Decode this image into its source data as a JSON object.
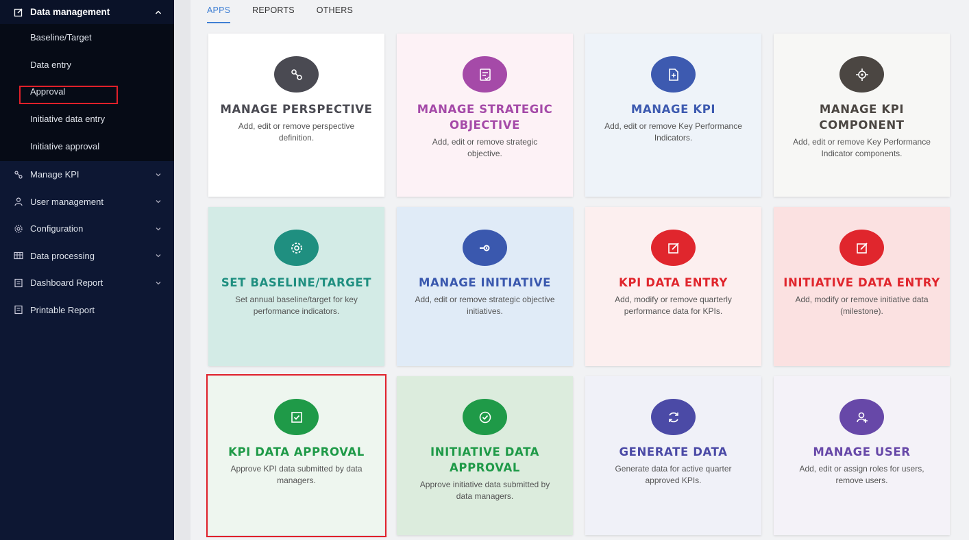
{
  "sidebar": {
    "group": {
      "label": "Data management"
    },
    "subitems": [
      {
        "label": "Baseline/Target"
      },
      {
        "label": "Data entry"
      },
      {
        "label": "Approval"
      },
      {
        "label": "Initiative data entry"
      },
      {
        "label": "Initiative approval"
      }
    ],
    "items": [
      {
        "label": "Manage KPI",
        "icon": "kpi-icon"
      },
      {
        "label": "User management",
        "icon": "user-icon"
      },
      {
        "label": "Configuration",
        "icon": "gear-icon"
      },
      {
        "label": "Data processing",
        "icon": "table-icon"
      },
      {
        "label": "Dashboard Report",
        "icon": "report-icon"
      },
      {
        "label": "Printable Report",
        "icon": "report-icon"
      }
    ]
  },
  "tabs": [
    {
      "label": "APPS",
      "active": true
    },
    {
      "label": "REPORTS"
    },
    {
      "label": "OTHERS"
    }
  ],
  "cards": [
    {
      "title": "MANAGE PERSPECTIVE",
      "desc": "Add, edit or remove perspective definition.",
      "icon": "perspective-icon",
      "color": "#4a4a52",
      "bg": "#ffffff"
    },
    {
      "title": "MANAGE STRATEGIC OBJECTIVE",
      "desc": "Add, edit or remove strategic objective.",
      "icon": "objective-icon",
      "color": "#a54aa8",
      "bg": "#fdf2f6"
    },
    {
      "title": "MANAGE KPI",
      "desc": "Add, edit or remove Key Performance Indicators.",
      "icon": "kpi-doc-icon",
      "color": "#3d5ab0",
      "bg": "#eef3f9"
    },
    {
      "title": "MANAGE KPI COMPONENT",
      "desc": "Add, edit or remove Key Performance Indicator components.",
      "icon": "target-icon",
      "color": "#4b4642",
      "bg": "#f7f7f5"
    },
    {
      "title": "SET BASELINE/TARGET",
      "desc": "Set annual baseline/target for key performance indicators.",
      "icon": "gear-icon",
      "color": "#1f8f80",
      "bg": "#d3ebe6"
    },
    {
      "title": "MANAGE INITIATIVE",
      "desc": "Add, edit or remove strategic objective initiatives.",
      "icon": "initiative-icon",
      "color": "#3a58ae",
      "bg": "#e0ebf7"
    },
    {
      "title": "KPI DATA ENTRY",
      "desc": "Add, modify or remove quarterly performance data for KPIs.",
      "icon": "edit-icon",
      "color": "#e0262d",
      "bg": "#fcefef"
    },
    {
      "title": "INITIATIVE DATA ENTRY",
      "desc": "Add, modify or remove initiative data (milestone).",
      "icon": "edit-icon",
      "color": "#e0262d",
      "bg": "#fbe1e1"
    },
    {
      "title": "KPI DATA APPROVAL",
      "desc": "Approve KPI data submitted by data managers.",
      "icon": "check-square-icon",
      "color": "#1f9a48",
      "bg": "#eef6ef"
    },
    {
      "title": "INITIATIVE DATA APPROVAL",
      "desc": "Approve initiative data submitted by data managers.",
      "icon": "check-circle-icon",
      "color": "#1f9a48",
      "bg": "#dcecdd"
    },
    {
      "title": "GENERATE DATA",
      "desc": "Generate data for active quarter approved KPIs.",
      "icon": "refresh-icon",
      "color": "#4b4aa6",
      "bg": "#f0f1f8"
    },
    {
      "title": "MANAGE USER",
      "desc": "Add, edit or assign roles for users, remove users.",
      "icon": "user-add-icon",
      "color": "#6748a8",
      "bg": "#f4f2f8"
    }
  ]
}
